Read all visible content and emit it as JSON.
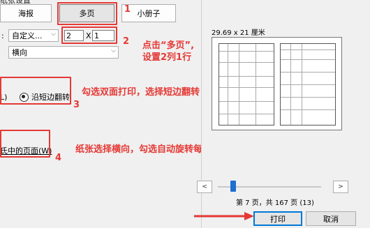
{
  "header_cut_text": "纸张设置",
  "pages_per_sheet": {
    "options": [
      {
        "label": "海报"
      },
      {
        "label": "多页"
      },
      {
        "label": "小册子"
      }
    ],
    "selected": "多页"
  },
  "layout": {
    "row_label": ":",
    "custom_select": "自定义...",
    "cols": "2",
    "times": "X",
    "rows": "1",
    "orientation_select": "横向"
  },
  "duplex": {
    "left_cut_text": "L)",
    "short_edge_label": "沿短边翻转"
  },
  "autorotate": {
    "label_cut": "氏中的页面(W)"
  },
  "annotations": {
    "n1": "1",
    "n2": "2",
    "n3": "3",
    "n4": "4",
    "a2_line1": "点击“多页”,",
    "a2_line2": "设置2列1行",
    "a3": "勾选双面打印，选择短边翻转",
    "a4": "纸张选择横向，勾选自动旋转每张纸中的页面"
  },
  "preview": {
    "paper_size": "29.69 x 21 厘米",
    "page_info": "第 7 页，共 167 页 (13)",
    "slider_position": 0.12
  },
  "buttons": {
    "print": "打印",
    "cancel": "取消"
  },
  "colors": {
    "annotation_red": "#e53935",
    "accent_blue": "#0078d7"
  }
}
